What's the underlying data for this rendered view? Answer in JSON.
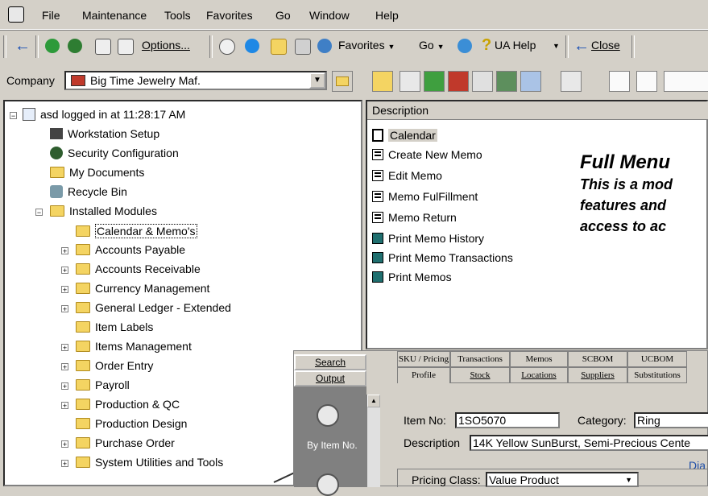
{
  "menu": {
    "file": "File",
    "maintenance": "Maintenance",
    "tools": "Tools",
    "favorites": "Favorites",
    "go": "Go",
    "window": "Window",
    "help": "Help"
  },
  "toolbar": {
    "options": "Options...",
    "favorites": "Favorites",
    "go": "Go",
    "ua_help": "UA Help",
    "close": "Close"
  },
  "company": {
    "label": "Company",
    "value": "Big Time Jewelry Maf."
  },
  "tree": {
    "root": "asd logged in at 11:28:17 AM",
    "workstation": "Workstation Setup",
    "security": "Security Configuration",
    "documents": "My Documents",
    "recycle": "Recycle Bin",
    "installed": "Installed Modules",
    "modules": [
      "Calendar & Memo's",
      "Accounts Payable",
      "Accounts Receivable",
      "Currency Management",
      "General Ledger - Extended",
      "Item Labels",
      "Items Management",
      "Order Entry",
      "Payroll",
      "Production & QC",
      "Production Design",
      "Purchase Order",
      "System Utilities and Tools"
    ]
  },
  "list": {
    "header": "Description",
    "items": [
      "Calendar",
      "Create New Memo",
      "Edit Memo",
      "Memo FulFillment",
      "Memo Return",
      "Print Memo History",
      "Print Memo Transactions",
      "Print Memos"
    ]
  },
  "fullmenu": {
    "title": "Full Menu",
    "line1": "This is a mod",
    "line2": "features and",
    "line3": "access to ac"
  },
  "overlay": {
    "search": "Search",
    "output": "Output",
    "by_item": "By Item No.",
    "tabs_row1": [
      "SKU / Pricing",
      "Transactions",
      "Memos",
      "SCBOM",
      "UCBOM"
    ],
    "tabs_row2": [
      "Profile",
      "Stock",
      "Locations",
      "Suppliers",
      "Substitutions"
    ],
    "item_no_label": "Item No:",
    "item_no_value": "1SO5070",
    "category_label": "Category:",
    "category_value": "Ring",
    "description_label": "Description",
    "description_value": "14K Yellow SunBurst, Semi-Precious Cente",
    "dia": "Dia",
    "pricing_label": "Pricing Class:",
    "pricing_value": "Value Product"
  }
}
